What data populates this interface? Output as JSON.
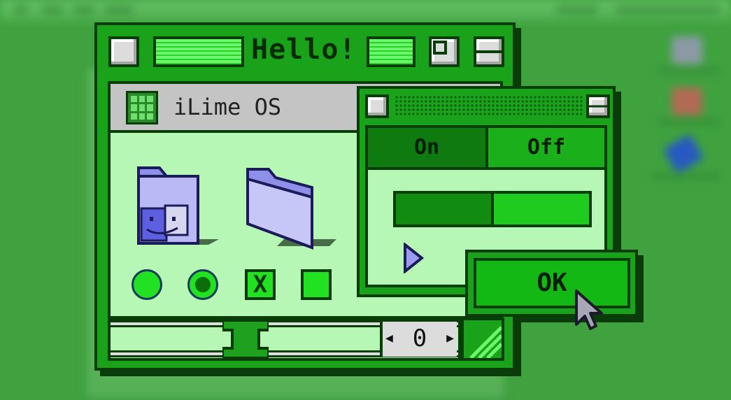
{
  "desktop": {
    "background": "#3fa23f"
  },
  "window_main": {
    "title": "Hello!",
    "inner_title": "iLime OS",
    "folders": [
      "finder-folder-icon",
      "folder-icon"
    ],
    "controls": [
      "radio-unselected",
      "radio-selected",
      "checkbox-checked",
      "checkbox-unchecked"
    ],
    "checkbox_mark": "X",
    "stepper_value": "0"
  },
  "window_small": {
    "toggle": {
      "on_label": "On",
      "off_label": "Off",
      "selected": "On"
    },
    "progress_fraction": 0.5,
    "play_icon": "play-triangle-icon"
  },
  "dialog": {
    "ok_label": "OK"
  },
  "colors": {
    "accent": "#1aa31a",
    "dark": "#083d08",
    "light_panel": "#b6f7b6",
    "bright_green": "#22e022"
  }
}
